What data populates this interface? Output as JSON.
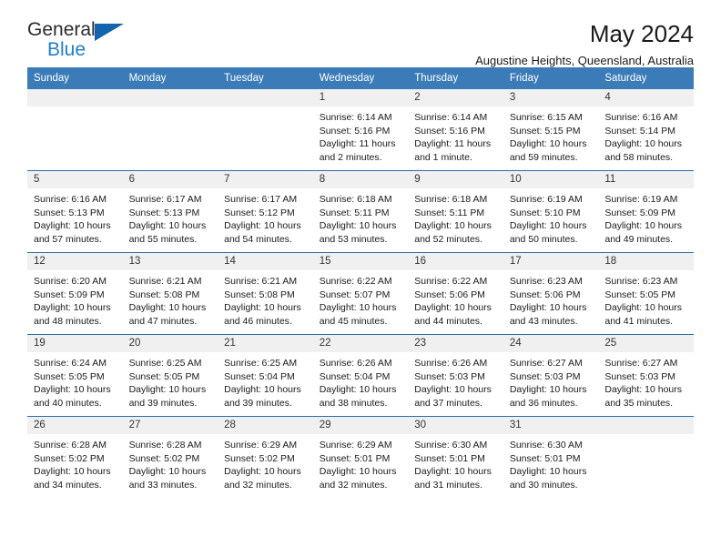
{
  "brand": {
    "name_top": "General",
    "name_bottom": "Blue",
    "accent_color": "#1463ad",
    "text_color": "#2b2b2b"
  },
  "header": {
    "title": "May 2024",
    "subtitle": "Augustine Heights, Queensland, Australia"
  },
  "theme": {
    "header_row_bg": "#3b7cb8",
    "cell_border": "#2e6da4",
    "date_strip_bg": "#f0f0f0"
  },
  "weekdays": [
    "Sunday",
    "Monday",
    "Tuesday",
    "Wednesday",
    "Thursday",
    "Friday",
    "Saturday"
  ],
  "labels": {
    "sunrise_prefix": "Sunrise: ",
    "sunset_prefix": "Sunset: ",
    "daylight_prefix": "Daylight: "
  },
  "weeks": [
    [
      {
        "day": "",
        "empty": true
      },
      {
        "day": "",
        "empty": true
      },
      {
        "day": "",
        "empty": true
      },
      {
        "day": "1",
        "sunrise": "Sunrise: 6:14 AM",
        "sunset": "Sunset: 5:16 PM",
        "daylight": "Daylight: 11 hours and 2 minutes."
      },
      {
        "day": "2",
        "sunrise": "Sunrise: 6:14 AM",
        "sunset": "Sunset: 5:16 PM",
        "daylight": "Daylight: 11 hours and 1 minute."
      },
      {
        "day": "3",
        "sunrise": "Sunrise: 6:15 AM",
        "sunset": "Sunset: 5:15 PM",
        "daylight": "Daylight: 10 hours and 59 minutes."
      },
      {
        "day": "4",
        "sunrise": "Sunrise: 6:16 AM",
        "sunset": "Sunset: 5:14 PM",
        "daylight": "Daylight: 10 hours and 58 minutes."
      }
    ],
    [
      {
        "day": "5",
        "sunrise": "Sunrise: 6:16 AM",
        "sunset": "Sunset: 5:13 PM",
        "daylight": "Daylight: 10 hours and 57 minutes."
      },
      {
        "day": "6",
        "sunrise": "Sunrise: 6:17 AM",
        "sunset": "Sunset: 5:13 PM",
        "daylight": "Daylight: 10 hours and 55 minutes."
      },
      {
        "day": "7",
        "sunrise": "Sunrise: 6:17 AM",
        "sunset": "Sunset: 5:12 PM",
        "daylight": "Daylight: 10 hours and 54 minutes."
      },
      {
        "day": "8",
        "sunrise": "Sunrise: 6:18 AM",
        "sunset": "Sunset: 5:11 PM",
        "daylight": "Daylight: 10 hours and 53 minutes."
      },
      {
        "day": "9",
        "sunrise": "Sunrise: 6:18 AM",
        "sunset": "Sunset: 5:11 PM",
        "daylight": "Daylight: 10 hours and 52 minutes."
      },
      {
        "day": "10",
        "sunrise": "Sunrise: 6:19 AM",
        "sunset": "Sunset: 5:10 PM",
        "daylight": "Daylight: 10 hours and 50 minutes."
      },
      {
        "day": "11",
        "sunrise": "Sunrise: 6:19 AM",
        "sunset": "Sunset: 5:09 PM",
        "daylight": "Daylight: 10 hours and 49 minutes."
      }
    ],
    [
      {
        "day": "12",
        "sunrise": "Sunrise: 6:20 AM",
        "sunset": "Sunset: 5:09 PM",
        "daylight": "Daylight: 10 hours and 48 minutes."
      },
      {
        "day": "13",
        "sunrise": "Sunrise: 6:21 AM",
        "sunset": "Sunset: 5:08 PM",
        "daylight": "Daylight: 10 hours and 47 minutes."
      },
      {
        "day": "14",
        "sunrise": "Sunrise: 6:21 AM",
        "sunset": "Sunset: 5:08 PM",
        "daylight": "Daylight: 10 hours and 46 minutes."
      },
      {
        "day": "15",
        "sunrise": "Sunrise: 6:22 AM",
        "sunset": "Sunset: 5:07 PM",
        "daylight": "Daylight: 10 hours and 45 minutes."
      },
      {
        "day": "16",
        "sunrise": "Sunrise: 6:22 AM",
        "sunset": "Sunset: 5:06 PM",
        "daylight": "Daylight: 10 hours and 44 minutes."
      },
      {
        "day": "17",
        "sunrise": "Sunrise: 6:23 AM",
        "sunset": "Sunset: 5:06 PM",
        "daylight": "Daylight: 10 hours and 43 minutes."
      },
      {
        "day": "18",
        "sunrise": "Sunrise: 6:23 AM",
        "sunset": "Sunset: 5:05 PM",
        "daylight": "Daylight: 10 hours and 41 minutes."
      }
    ],
    [
      {
        "day": "19",
        "sunrise": "Sunrise: 6:24 AM",
        "sunset": "Sunset: 5:05 PM",
        "daylight": "Daylight: 10 hours and 40 minutes."
      },
      {
        "day": "20",
        "sunrise": "Sunrise: 6:25 AM",
        "sunset": "Sunset: 5:05 PM",
        "daylight": "Daylight: 10 hours and 39 minutes."
      },
      {
        "day": "21",
        "sunrise": "Sunrise: 6:25 AM",
        "sunset": "Sunset: 5:04 PM",
        "daylight": "Daylight: 10 hours and 39 minutes."
      },
      {
        "day": "22",
        "sunrise": "Sunrise: 6:26 AM",
        "sunset": "Sunset: 5:04 PM",
        "daylight": "Daylight: 10 hours and 38 minutes."
      },
      {
        "day": "23",
        "sunrise": "Sunrise: 6:26 AM",
        "sunset": "Sunset: 5:03 PM",
        "daylight": "Daylight: 10 hours and 37 minutes."
      },
      {
        "day": "24",
        "sunrise": "Sunrise: 6:27 AM",
        "sunset": "Sunset: 5:03 PM",
        "daylight": "Daylight: 10 hours and 36 minutes."
      },
      {
        "day": "25",
        "sunrise": "Sunrise: 6:27 AM",
        "sunset": "Sunset: 5:03 PM",
        "daylight": "Daylight: 10 hours and 35 minutes."
      }
    ],
    [
      {
        "day": "26",
        "sunrise": "Sunrise: 6:28 AM",
        "sunset": "Sunset: 5:02 PM",
        "daylight": "Daylight: 10 hours and 34 minutes."
      },
      {
        "day": "27",
        "sunrise": "Sunrise: 6:28 AM",
        "sunset": "Sunset: 5:02 PM",
        "daylight": "Daylight: 10 hours and 33 minutes."
      },
      {
        "day": "28",
        "sunrise": "Sunrise: 6:29 AM",
        "sunset": "Sunset: 5:02 PM",
        "daylight": "Daylight: 10 hours and 32 minutes."
      },
      {
        "day": "29",
        "sunrise": "Sunrise: 6:29 AM",
        "sunset": "Sunset: 5:01 PM",
        "daylight": "Daylight: 10 hours and 32 minutes."
      },
      {
        "day": "30",
        "sunrise": "Sunrise: 6:30 AM",
        "sunset": "Sunset: 5:01 PM",
        "daylight": "Daylight: 10 hours and 31 minutes."
      },
      {
        "day": "31",
        "sunrise": "Sunrise: 6:30 AM",
        "sunset": "Sunset: 5:01 PM",
        "daylight": "Daylight: 10 hours and 30 minutes."
      },
      {
        "day": "",
        "empty": true
      }
    ]
  ]
}
